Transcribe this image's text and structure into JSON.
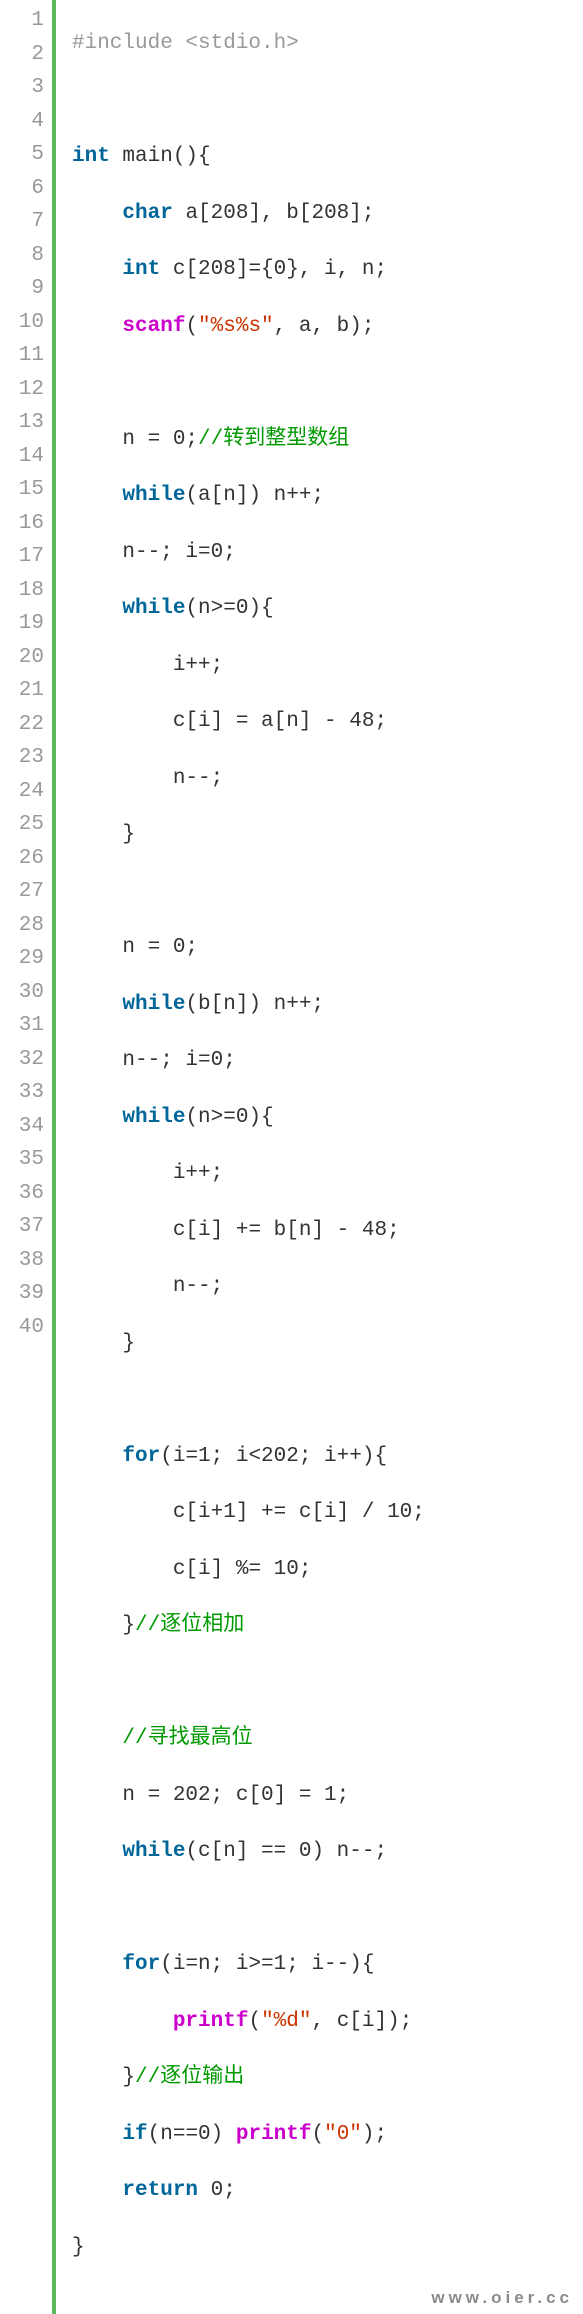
{
  "watermark": "www.oier.cc",
  "line_count": 40,
  "lines": {
    "l1": {
      "pp": "#include <stdio.h>"
    },
    "l2": {},
    "l3": {
      "kw0": "int",
      "t0": " main(){"
    },
    "l4": {
      "kw0": "char",
      "t0": " a[208], b[208];"
    },
    "l5": {
      "kw0": "int",
      "t0": " c[208]={0}, i, n;"
    },
    "l6": {
      "fn0": "scanf",
      "t0": "(",
      "s0": "\"%s%s\"",
      "t1": ", a, b);"
    },
    "l7": {},
    "l8": {
      "t0": "n = 0;",
      "cm0": "//转到整型数组"
    },
    "l9": {
      "kw0": "while",
      "t0": "(a[n]) n++;"
    },
    "l10": {
      "t0": "n--; i=0;"
    },
    "l11": {
      "kw0": "while",
      "t0": "(n>=0){"
    },
    "l12": {
      "t0": "i++;"
    },
    "l13": {
      "t0": "c[i] = a[n] - 48;"
    },
    "l14": {
      "t0": "n--;"
    },
    "l15": {
      "t0": "}"
    },
    "l16": {},
    "l17": {
      "t0": "n = 0;"
    },
    "l18": {
      "kw0": "while",
      "t0": "(b[n]) n++;"
    },
    "l19": {
      "t0": "n--; i=0;"
    },
    "l20": {
      "kw0": "while",
      "t0": "(n>=0){"
    },
    "l21": {
      "t0": "i++;"
    },
    "l22": {
      "t0": "c[i] += b[n] - 48;"
    },
    "l23": {
      "t0": "n--;"
    },
    "l24": {
      "t0": "}"
    },
    "l25": {},
    "l26": {
      "kw0": "for",
      "t0": "(i=1; i<202; i++){"
    },
    "l27": {
      "t0": "c[i+1] += c[i] / 10;"
    },
    "l28": {
      "t0": "c[i] %= 10;"
    },
    "l29": {
      "t0": "}",
      "cm0": "//逐位相加"
    },
    "l30": {},
    "l31": {
      "cm0": "//寻找最高位"
    },
    "l32": {
      "t0": "n = 202; c[0] = 1;"
    },
    "l33": {
      "kw0": "while",
      "t0": "(c[n] == 0) n--;"
    },
    "l34": {},
    "l35": {
      "kw0": "for",
      "t0": "(i=n; i>=1; i--){"
    },
    "l36": {
      "fn0": "printf",
      "t0": "(",
      "s0": "\"%d\"",
      "t1": ", c[i]);"
    },
    "l37": {
      "t0": "}",
      "cm0": "//逐位输出"
    },
    "l38": {
      "kw0": "if",
      "t0": "(n==0) ",
      "fn0": "printf",
      "t1": "(",
      "s0": "\"0\"",
      "t2": ");"
    },
    "l39": {
      "kw0": "return",
      "t0": " 0;"
    },
    "l40": {
      "t0": "}"
    }
  },
  "indent": {
    "l1": 0,
    "l3": 0,
    "l4": 1,
    "l5": 1,
    "l6": 1,
    "l8": 1,
    "l9": 1,
    "l10": 1,
    "l11": 1,
    "l12": 2,
    "l13": 2,
    "l14": 2,
    "l15": 1,
    "l17": 1,
    "l18": 1,
    "l19": 1,
    "l20": 1,
    "l21": 2,
    "l22": 2,
    "l23": 2,
    "l24": 1,
    "l26": 1,
    "l27": 2,
    "l28": 2,
    "l29": 1,
    "l31": 1,
    "l32": 1,
    "l33": 1,
    "l35": 1,
    "l36": 2,
    "l37": 1,
    "l38": 1,
    "l39": 1,
    "l40": 0
  }
}
